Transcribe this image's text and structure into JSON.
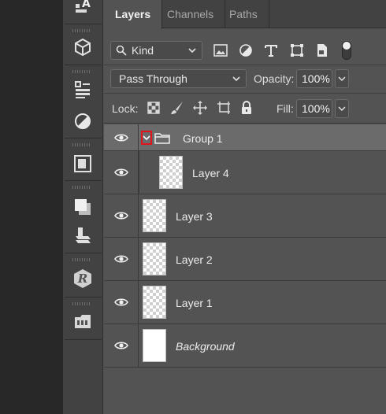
{
  "tabs": [
    {
      "label": "Layers",
      "active": true
    },
    {
      "label": "Channels",
      "active": false
    },
    {
      "label": "Paths",
      "active": false
    }
  ],
  "filter": {
    "kind_label": "Kind",
    "icons": [
      "image-filter-icon",
      "adjustment-filter-icon",
      "type-filter-icon",
      "shape-filter-icon",
      "smart-object-filter-icon"
    ]
  },
  "blend": {
    "mode": "Pass Through",
    "opacity_label": "Opacity:",
    "opacity_value": "100%"
  },
  "lock": {
    "label": "Lock:",
    "icons": [
      "lock-transparent-icon",
      "lock-image-icon",
      "lock-position-icon",
      "lock-artboard-icon",
      "lock-all-icon"
    ],
    "fill_label": "Fill:",
    "fill_value": "100%"
  },
  "layers": [
    {
      "name": "Group 1",
      "type": "group",
      "expanded": true
    },
    {
      "name": "Layer 4",
      "type": "layer",
      "indented": true
    },
    {
      "name": "Layer 3",
      "type": "layer"
    },
    {
      "name": "Layer 2",
      "type": "layer"
    },
    {
      "name": "Layer 1",
      "type": "layer"
    },
    {
      "name": "Background",
      "type": "background"
    }
  ],
  "toolstrip_icons": [
    "character-icon",
    "3d-cube-icon",
    "properties-icon",
    "adjustments-icon",
    "libraries-icon",
    "layer-comps-icon",
    "shapes-icon",
    "plugin-r-icon",
    "artboard-icon"
  ],
  "colors": {
    "panel_bg": "#535353",
    "group_row": "#6b6b6b",
    "highlight": "#e0141a"
  }
}
